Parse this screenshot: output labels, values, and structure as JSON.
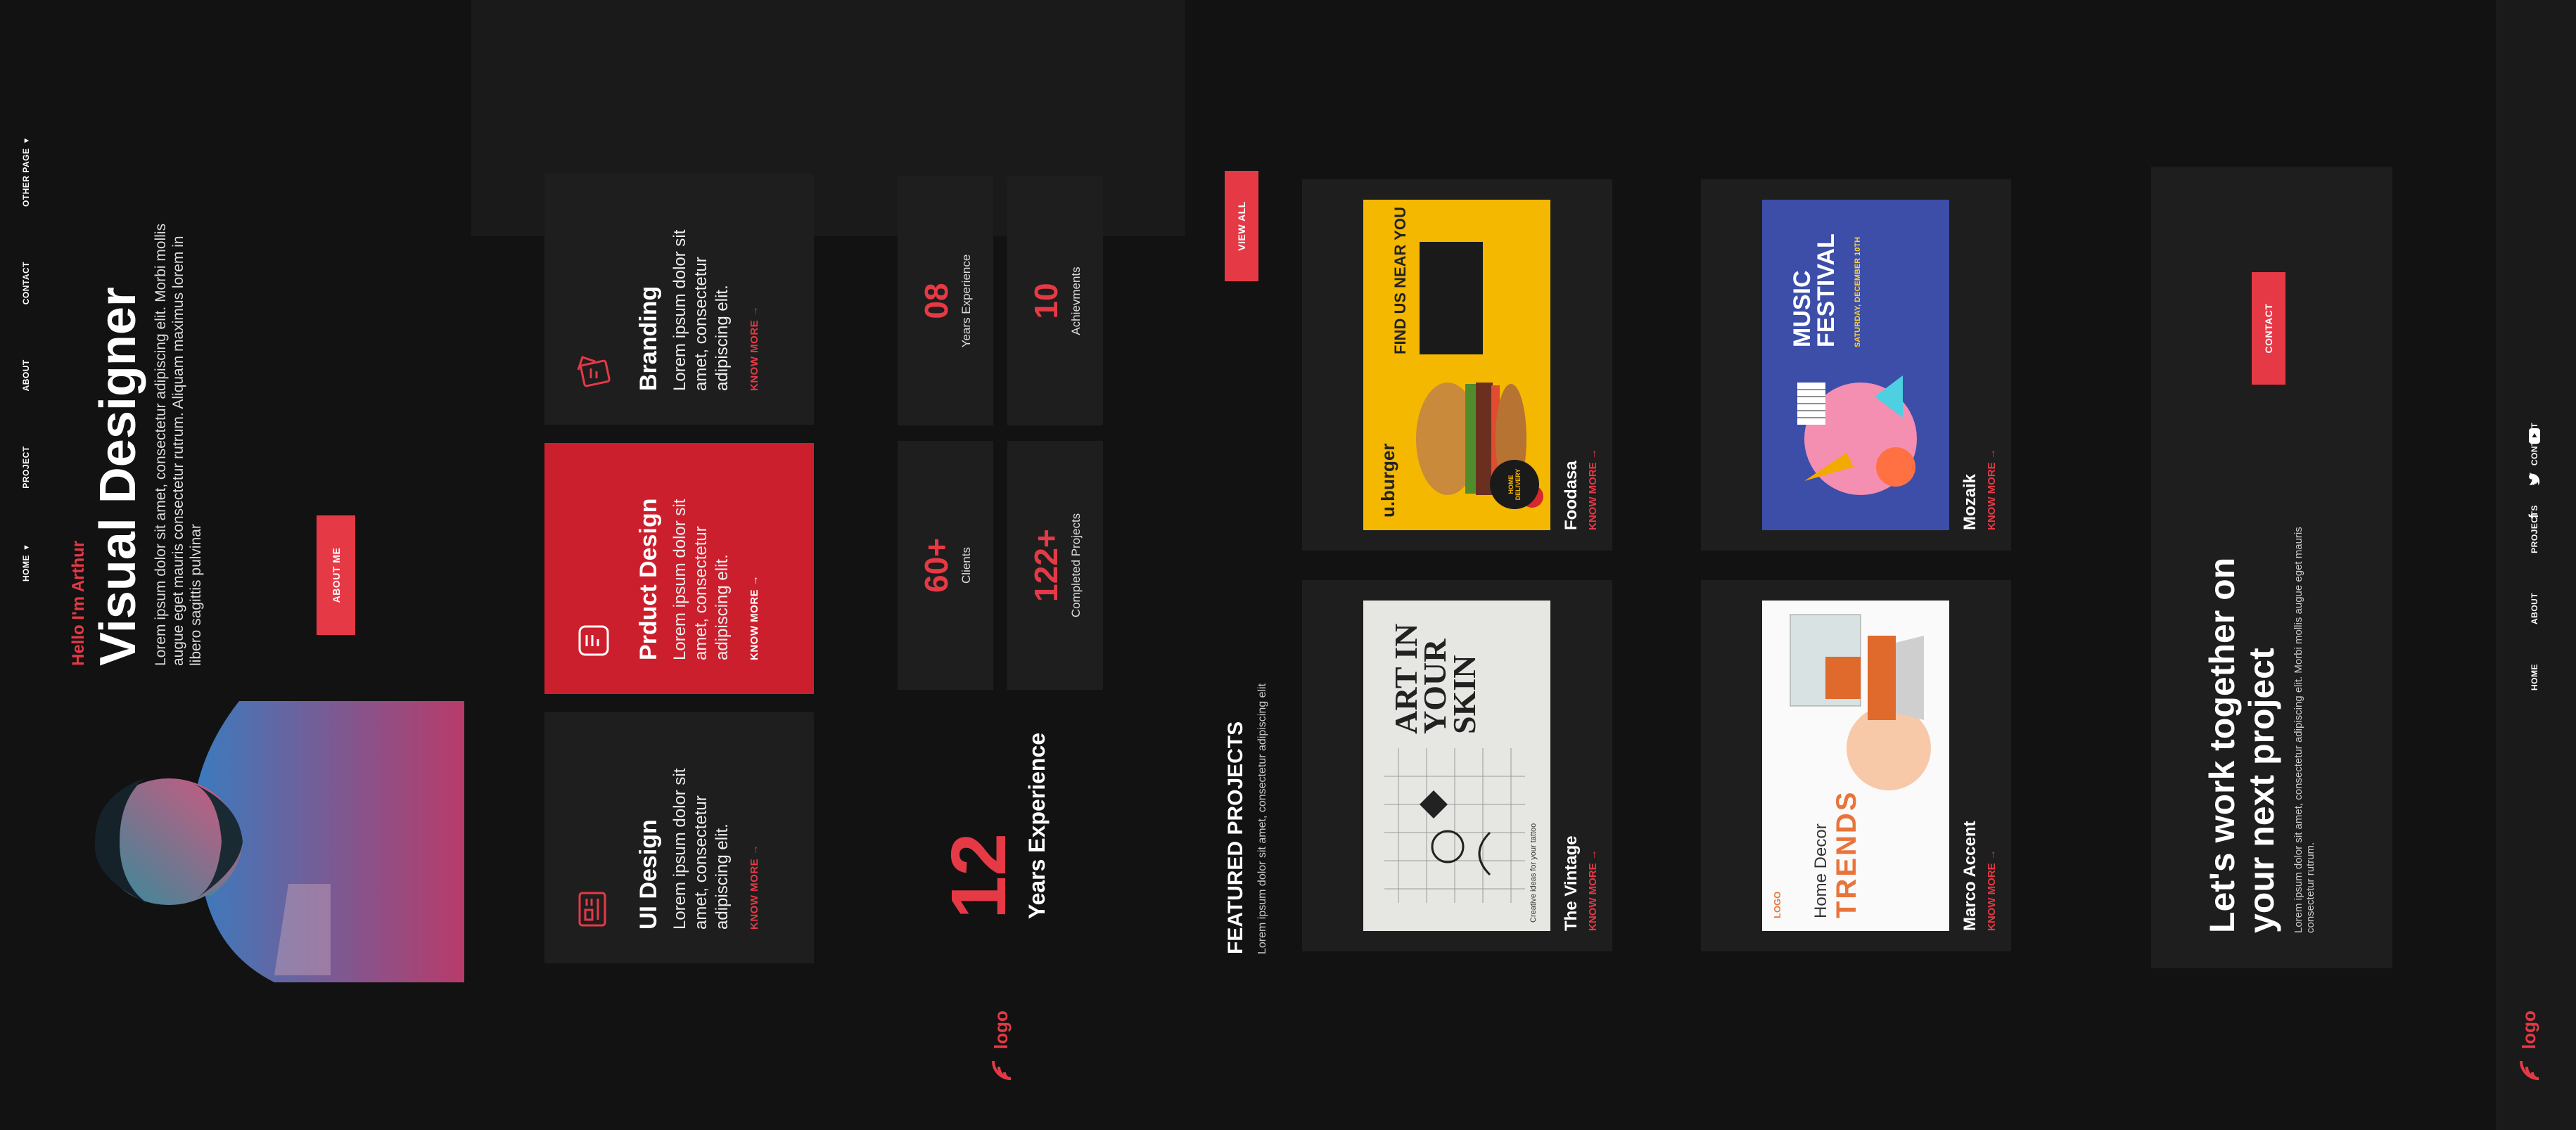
{
  "nav": {
    "items": [
      {
        "label": "HOME",
        "dropdown": true
      },
      {
        "label": "PROJECT",
        "dropdown": false
      },
      {
        "label": "ABOUT",
        "dropdown": false
      },
      {
        "label": "CONTACT",
        "dropdown": false
      },
      {
        "label": "OTHER PAGE",
        "dropdown": true
      }
    ],
    "logo": "logo"
  },
  "hero": {
    "greeting": "Hello I'm Arthur",
    "title": "Visual Designer",
    "description": "Lorem ipsum dolor sit amet, consectetur adipiscing elit. Morbi mollis augue eget mauris consectetur rutrum. Aliquam maximus lorem in libero sagittis pulvinar",
    "button": "ABOUT ME"
  },
  "services": [
    {
      "icon": "ui-design-icon",
      "title": "UI Design",
      "desc": "Lorem ipsum dolor sit amet, consectetur adipiscing elit.",
      "link": "KNOW MORE",
      "highlight": false
    },
    {
      "icon": "product-design-icon",
      "title": "Prduct Design",
      "desc": "Lorem ipsum dolor sit amet, consectetur adipiscing elit.",
      "link": "KNOW MORE",
      "highlight": true
    },
    {
      "icon": "branding-icon",
      "title": "Branding",
      "desc": "Lorem ipsum dolor sit amet, consectetur adipiscing elit.",
      "link": "KNOW MORE",
      "highlight": false
    }
  ],
  "experience": {
    "number": "12",
    "label": "Years Experience"
  },
  "stats": [
    {
      "num": "60+",
      "label": "Clients"
    },
    {
      "num": "08",
      "label": "Years Experience"
    },
    {
      "num": "122+",
      "label": "Completed Projects"
    },
    {
      "num": "10",
      "label": "Achievments"
    }
  ],
  "projects_section": {
    "title": "FEATURED PROJECTS",
    "desc": "Lorem ipsum dolor sit amet, consectetur adipiscing elit",
    "button": "VIEW ALL"
  },
  "projects": [
    {
      "title": "Foodasa",
      "link": "KNOW MORE"
    },
    {
      "title": "The Vintage",
      "link": "KNOW MORE"
    },
    {
      "title": "Mozaik",
      "link": "KNOW MORE"
    },
    {
      "title": "Marco Accent",
      "link": "KNOW MORE"
    }
  ],
  "thumb_text": {
    "burger_brand": "u.burger",
    "burger_heading": "FIND US NEAR YOU",
    "burger_badge": "HOME DELIVERY",
    "art_title": "ART IN YOUR SKIN",
    "art_footer": "Creative ideas for your tattoo",
    "festival_title": "MUSIC FESTIVAL",
    "festival_date": "SATURDAY, DECEMBER 10TH",
    "decor_logo": "LOGO",
    "decor_title1": "Home Decor",
    "decor_title2": "TRENDS"
  },
  "cta": {
    "title": "Let's work together on your next project",
    "desc": "Lorem ipsum dolor sit amet, consectetur adipiscing elit. Morbi mollis augue eget mauris consectetur rutrum.",
    "button": "CONTACT"
  },
  "footer": {
    "logo": "logo",
    "items": [
      "HOME",
      "ABOUT",
      "PROJECTS",
      "CONTACT"
    ],
    "social": [
      "facebook-icon",
      "twitter-icon",
      "youtube-icon"
    ]
  },
  "colors": {
    "accent": "#e63946",
    "background": "#121212",
    "panel": "#1e1e1e",
    "footer": "#1a1a1a"
  }
}
